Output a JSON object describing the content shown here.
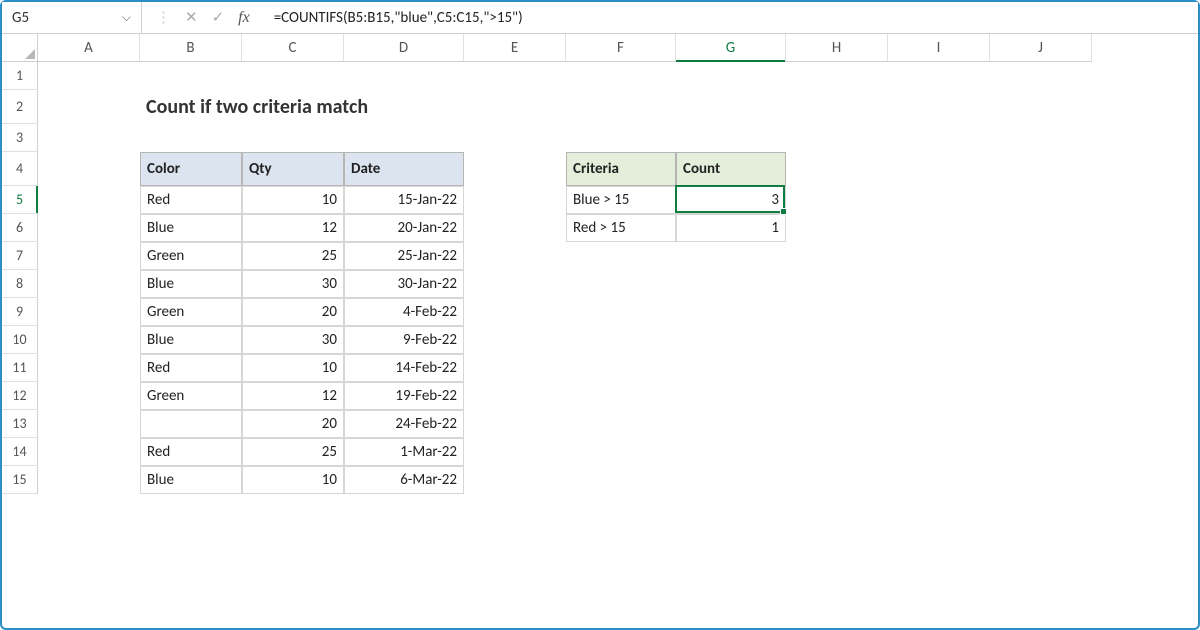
{
  "name_box": "G5",
  "formula": "=COUNTIFS(B5:B15,\"blue\",C5:C15,\">15\")",
  "fx_label": "fx",
  "columns": [
    "A",
    "B",
    "C",
    "D",
    "E",
    "F",
    "G",
    "H",
    "I",
    "J"
  ],
  "active_col": "G",
  "rows": [
    "1",
    "2",
    "3",
    "4",
    "5",
    "6",
    "7",
    "8",
    "9",
    "10",
    "11",
    "12",
    "13",
    "14",
    "15"
  ],
  "active_row": "5",
  "title": "Count if two criteria match",
  "table1": {
    "headers": [
      "Color",
      "Qty",
      "Date"
    ],
    "rows": [
      {
        "color": "Red",
        "qty": "10",
        "date": "15-Jan-22"
      },
      {
        "color": "Blue",
        "qty": "12",
        "date": "20-Jan-22"
      },
      {
        "color": "Green",
        "qty": "25",
        "date": "25-Jan-22"
      },
      {
        "color": "Blue",
        "qty": "30",
        "date": "30-Jan-22"
      },
      {
        "color": "Green",
        "qty": "20",
        "date": "4-Feb-22"
      },
      {
        "color": "Blue",
        "qty": "30",
        "date": "9-Feb-22"
      },
      {
        "color": "Red",
        "qty": "10",
        "date": "14-Feb-22"
      },
      {
        "color": "Green",
        "qty": "12",
        "date": "19-Feb-22"
      },
      {
        "color": "",
        "qty": "20",
        "date": "24-Feb-22"
      },
      {
        "color": "Red",
        "qty": "25",
        "date": "1-Mar-22"
      },
      {
        "color": "Blue",
        "qty": "10",
        "date": "6-Mar-22"
      }
    ]
  },
  "table2": {
    "headers": [
      "Criteria",
      "Count"
    ],
    "rows": [
      {
        "criteria": "Blue > 15",
        "count": "3"
      },
      {
        "criteria": "Red > 15",
        "count": "1"
      }
    ]
  }
}
